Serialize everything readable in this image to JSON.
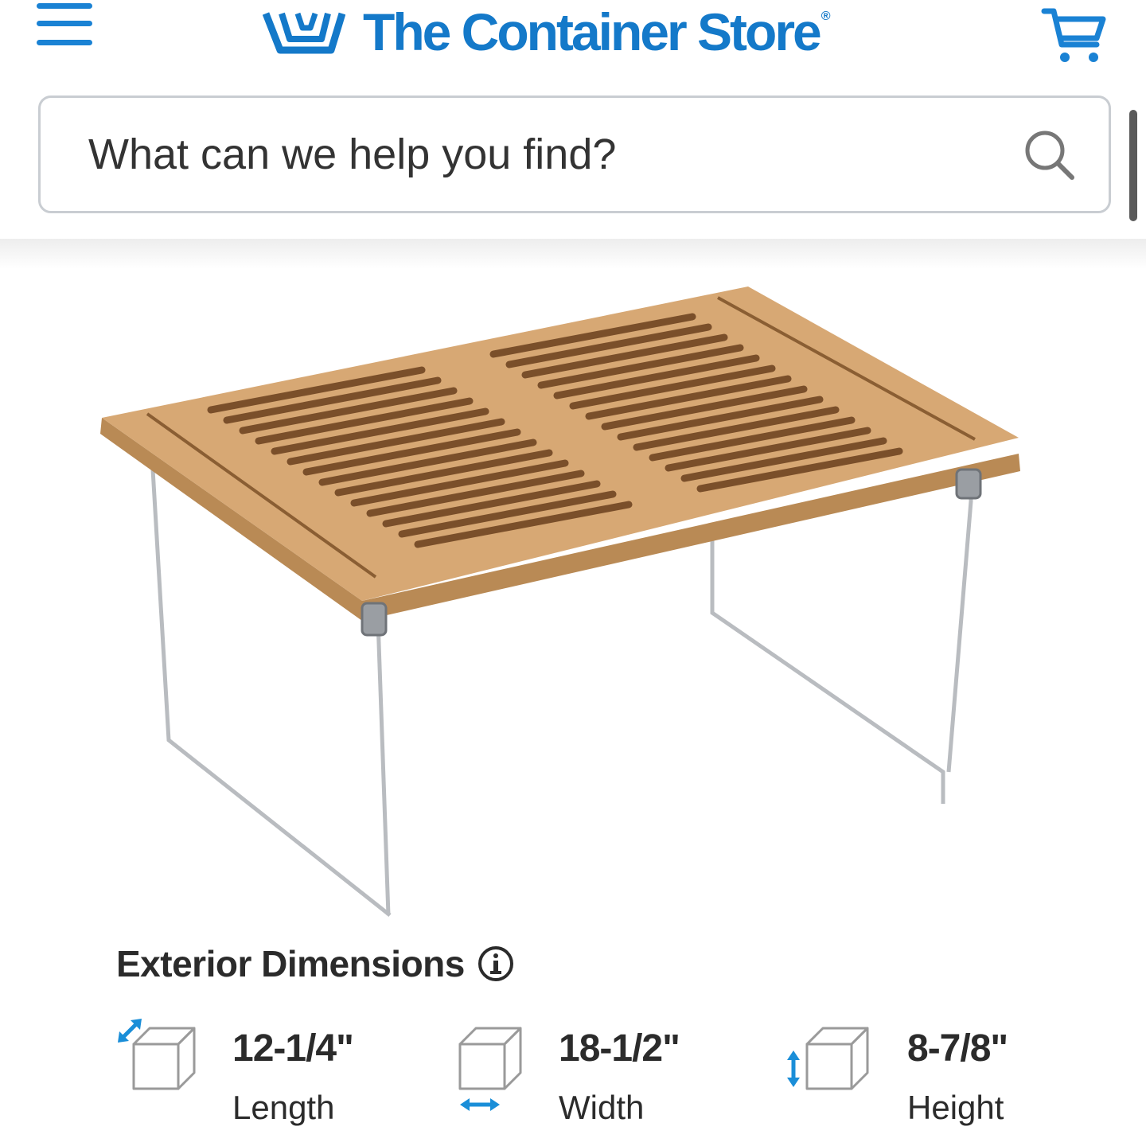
{
  "header": {
    "brand": "The Container Store",
    "brand_mark": "®",
    "accent_color": "#1479c9"
  },
  "search": {
    "placeholder": "What can we help you find?"
  },
  "product": {
    "image_name": "bamboo-stacking-shelf"
  },
  "dimensions": {
    "title": "Exterior Dimensions",
    "items": [
      {
        "value": "12-1/4\"",
        "label": "Length",
        "icon": "length-cube-icon"
      },
      {
        "value": "18-1/2\"",
        "label": "Width",
        "icon": "width-cube-icon"
      },
      {
        "value": "8-7/8\"",
        "label": "Height",
        "icon": "height-cube-icon"
      }
    ]
  }
}
